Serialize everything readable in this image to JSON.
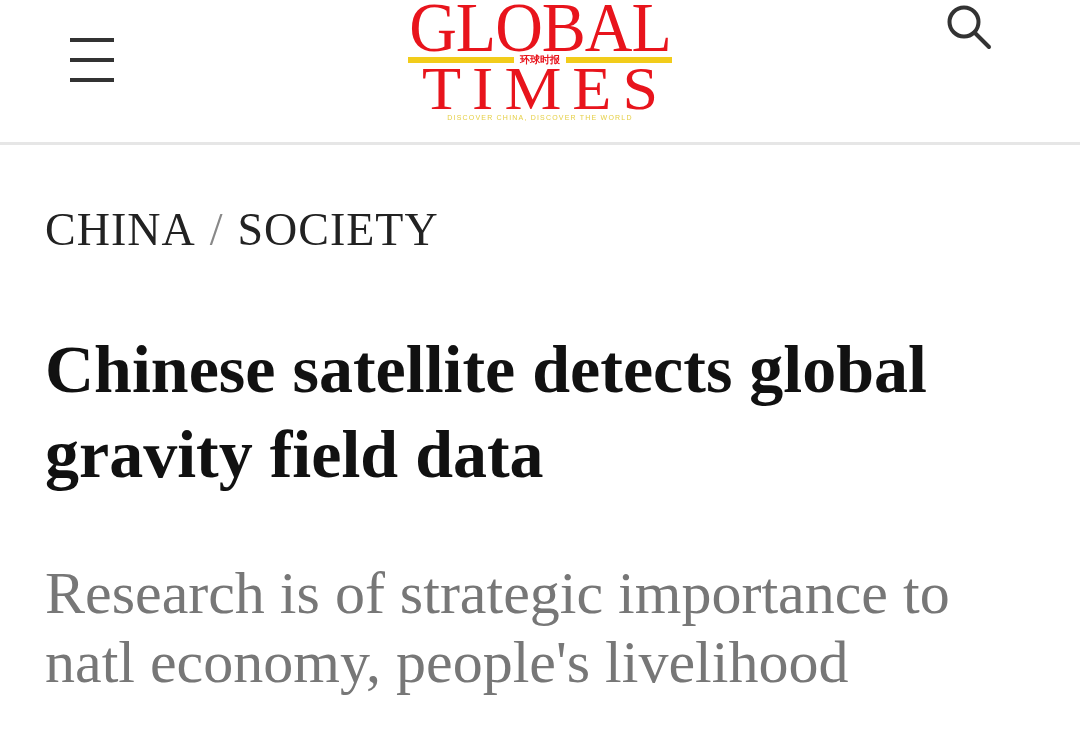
{
  "header": {
    "logo": {
      "title_top": "GLOBAL",
      "chinese_name": "环球时报",
      "title_bottom": "TIMES",
      "tagline": "DISCOVER CHINA, DISCOVER THE WORLD"
    }
  },
  "breadcrumb": {
    "items": [
      {
        "label": "CHINA"
      },
      {
        "label": "SOCIETY"
      }
    ],
    "separator": "/"
  },
  "article": {
    "headline": "Chinese satellite detects global gravity field data",
    "subheadline": "Research is of strategic importance to natl economy, people's livelihood"
  }
}
